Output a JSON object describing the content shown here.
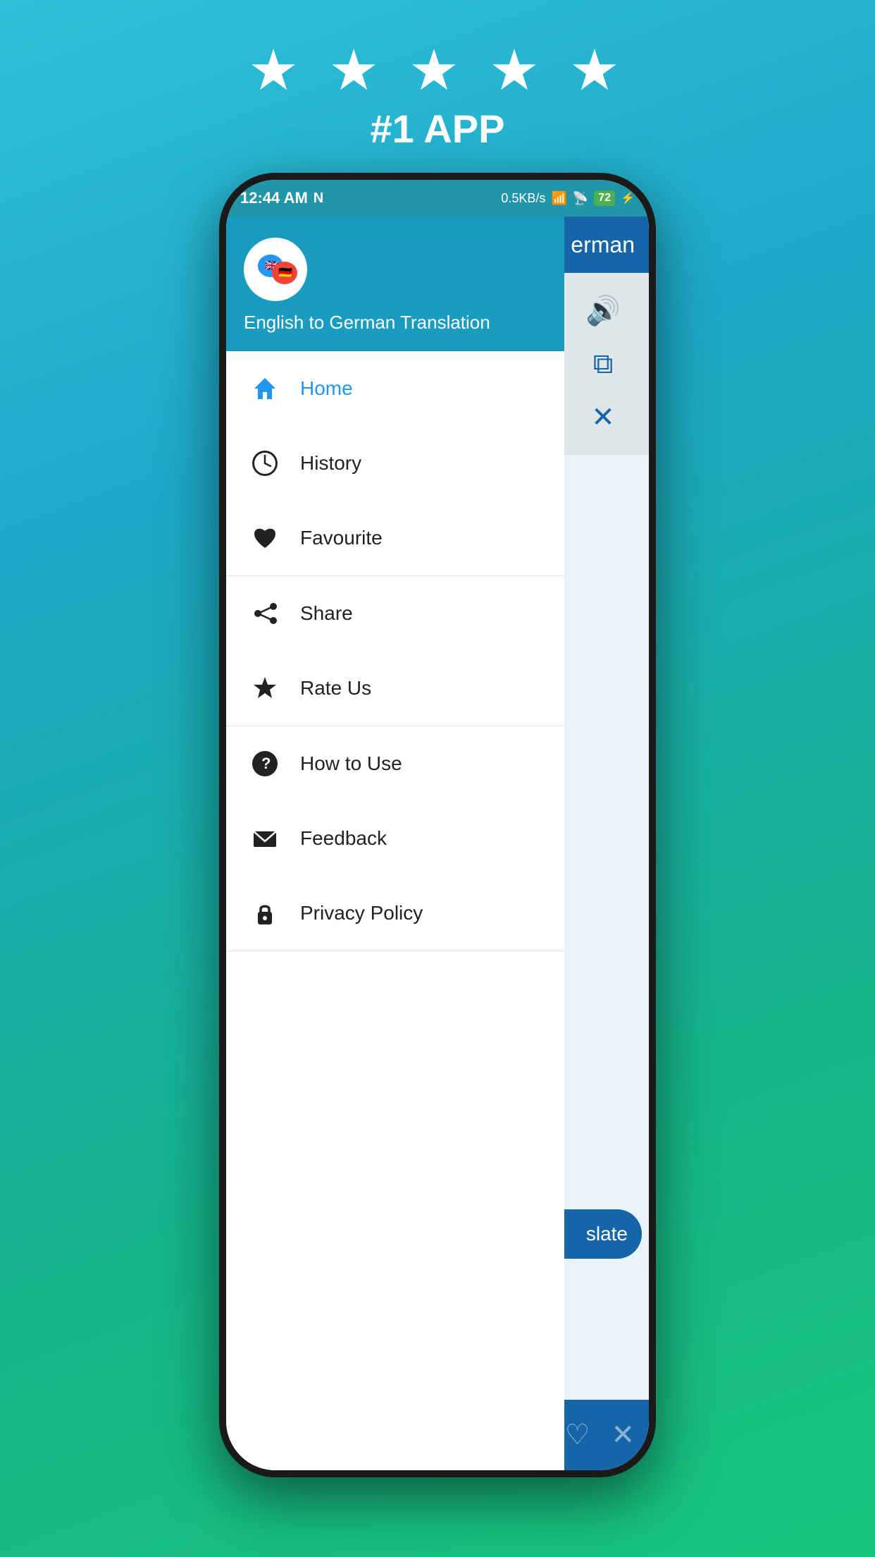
{
  "page": {
    "background_gradient": "linear-gradient(160deg, #2fc0d8 0%, #1da8c8 30%, #15b58a 70%, #18c47a 100%)"
  },
  "top": {
    "stars": "★ ★ ★ ★ ★",
    "rank_label": "#1 APP"
  },
  "status_bar": {
    "time": "12:44 AM",
    "network_icon": "N",
    "data_speed": "0.5KB/s",
    "signal_bars": "▐▐▐",
    "wifi": "WiFi",
    "battery_percent": "72",
    "battery_charging": "⚡"
  },
  "app_background": {
    "header_text": "erman",
    "translate_btn_text": "slate"
  },
  "drawer": {
    "app_name": "English to German Translation",
    "items": [
      {
        "id": "home",
        "label": "Home",
        "icon": "home",
        "active": true
      },
      {
        "id": "history",
        "label": "History",
        "icon": "clock",
        "active": false
      },
      {
        "id": "favourite",
        "label": "Favourite",
        "icon": "heart",
        "active": false
      },
      {
        "id": "share",
        "label": "Share",
        "icon": "share",
        "active": false
      },
      {
        "id": "rate-us",
        "label": "Rate Us",
        "icon": "star",
        "active": false
      },
      {
        "id": "how-to-use",
        "label": "How to Use",
        "icon": "help",
        "active": false
      },
      {
        "id": "feedback",
        "label": "Feedback",
        "icon": "email",
        "active": false
      },
      {
        "id": "privacy-policy",
        "label": "Privacy Policy",
        "icon": "lock",
        "active": false
      }
    ]
  }
}
